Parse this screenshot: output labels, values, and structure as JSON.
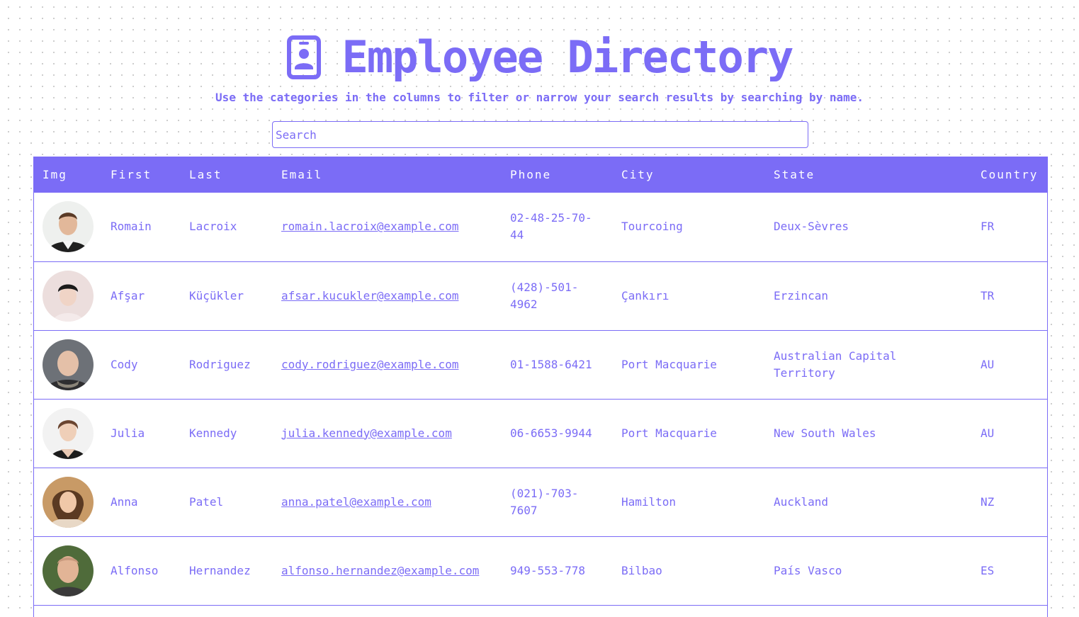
{
  "header": {
    "icon": "id-badge-icon",
    "title": "Employee Directory",
    "subtitle": "Use the categories in the columns to filter or narrow your search results by searching by name."
  },
  "search": {
    "placeholder": "Search",
    "value": ""
  },
  "colors": {
    "accent": "#7b6cf6",
    "header_text": "#ffffff",
    "background": "#ffffff"
  },
  "table": {
    "columns": [
      "Img",
      "First",
      "Last",
      "Email",
      "Phone",
      "City",
      "State",
      "Country"
    ],
    "rows": [
      {
        "first": "Romain",
        "last": "Lacroix",
        "email": "romain.lacroix@example.com",
        "phone": "02-48-25-70-44",
        "city": "Tourcoing",
        "state": "Deux-Sèvres",
        "country": "FR"
      },
      {
        "first": "Afşar",
        "last": "Küçükler",
        "email": "afsar.kucukler@example.com",
        "phone": "(428)-501-4962",
        "city": "Çankırı",
        "state": "Erzincan",
        "country": "TR"
      },
      {
        "first": "Cody",
        "last": "Rodriguez",
        "email": "cody.rodriguez@example.com",
        "phone": "01-1588-6421",
        "city": "Port Macquarie",
        "state": "Australian Capital Territory",
        "country": "AU"
      },
      {
        "first": "Julia",
        "last": "Kennedy",
        "email": "julia.kennedy@example.com",
        "phone": "06-6653-9944",
        "city": "Port Macquarie",
        "state": "New South Wales",
        "country": "AU"
      },
      {
        "first": "Anna",
        "last": "Patel",
        "email": "anna.patel@example.com",
        "phone": "(021)-703-7607",
        "city": "Hamilton",
        "state": "Auckland",
        "country": "NZ"
      },
      {
        "first": "Alfonso",
        "last": "Hernandez",
        "email": "alfonso.hernandez@example.com",
        "phone": "949-553-778",
        "city": "Bilbao",
        "state": "País Vasco",
        "country": "ES"
      }
    ]
  }
}
